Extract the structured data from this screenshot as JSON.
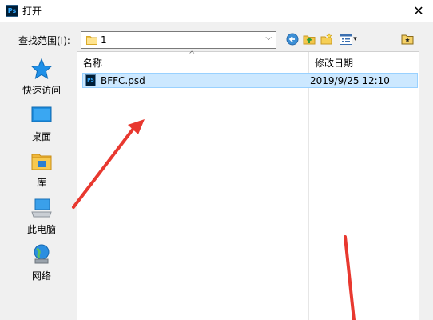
{
  "window": {
    "app_icon_text": "Ps",
    "title": "打开",
    "close_glyph": "✕"
  },
  "toolbar": {
    "look_in_label": "查找范围(I):",
    "look_in_value": "1",
    "dropdown_glyph": "⌵",
    "view_menu_arrow": "▾"
  },
  "sidebar": {
    "items": [
      {
        "label": "快速访问",
        "icon": "star-icon"
      },
      {
        "label": "桌面",
        "icon": "desktop-icon"
      },
      {
        "label": "库",
        "icon": "library-icon"
      },
      {
        "label": "此电脑",
        "icon": "computer-icon"
      },
      {
        "label": "网络",
        "icon": "network-icon"
      }
    ]
  },
  "filelist": {
    "columns": [
      {
        "label": "名称"
      },
      {
        "label": "修改日期"
      }
    ],
    "sort_glyph": "^",
    "rows": [
      {
        "name": "BFFC.psd",
        "date": "2019/9/25 12:10",
        "icon_text": "PS",
        "selected": true
      }
    ]
  },
  "colors": {
    "selection_bg": "#cce8ff",
    "selection_border": "#99d1ff",
    "arrow_red": "#e8382f",
    "accent_blue": "#3c8fd6"
  }
}
